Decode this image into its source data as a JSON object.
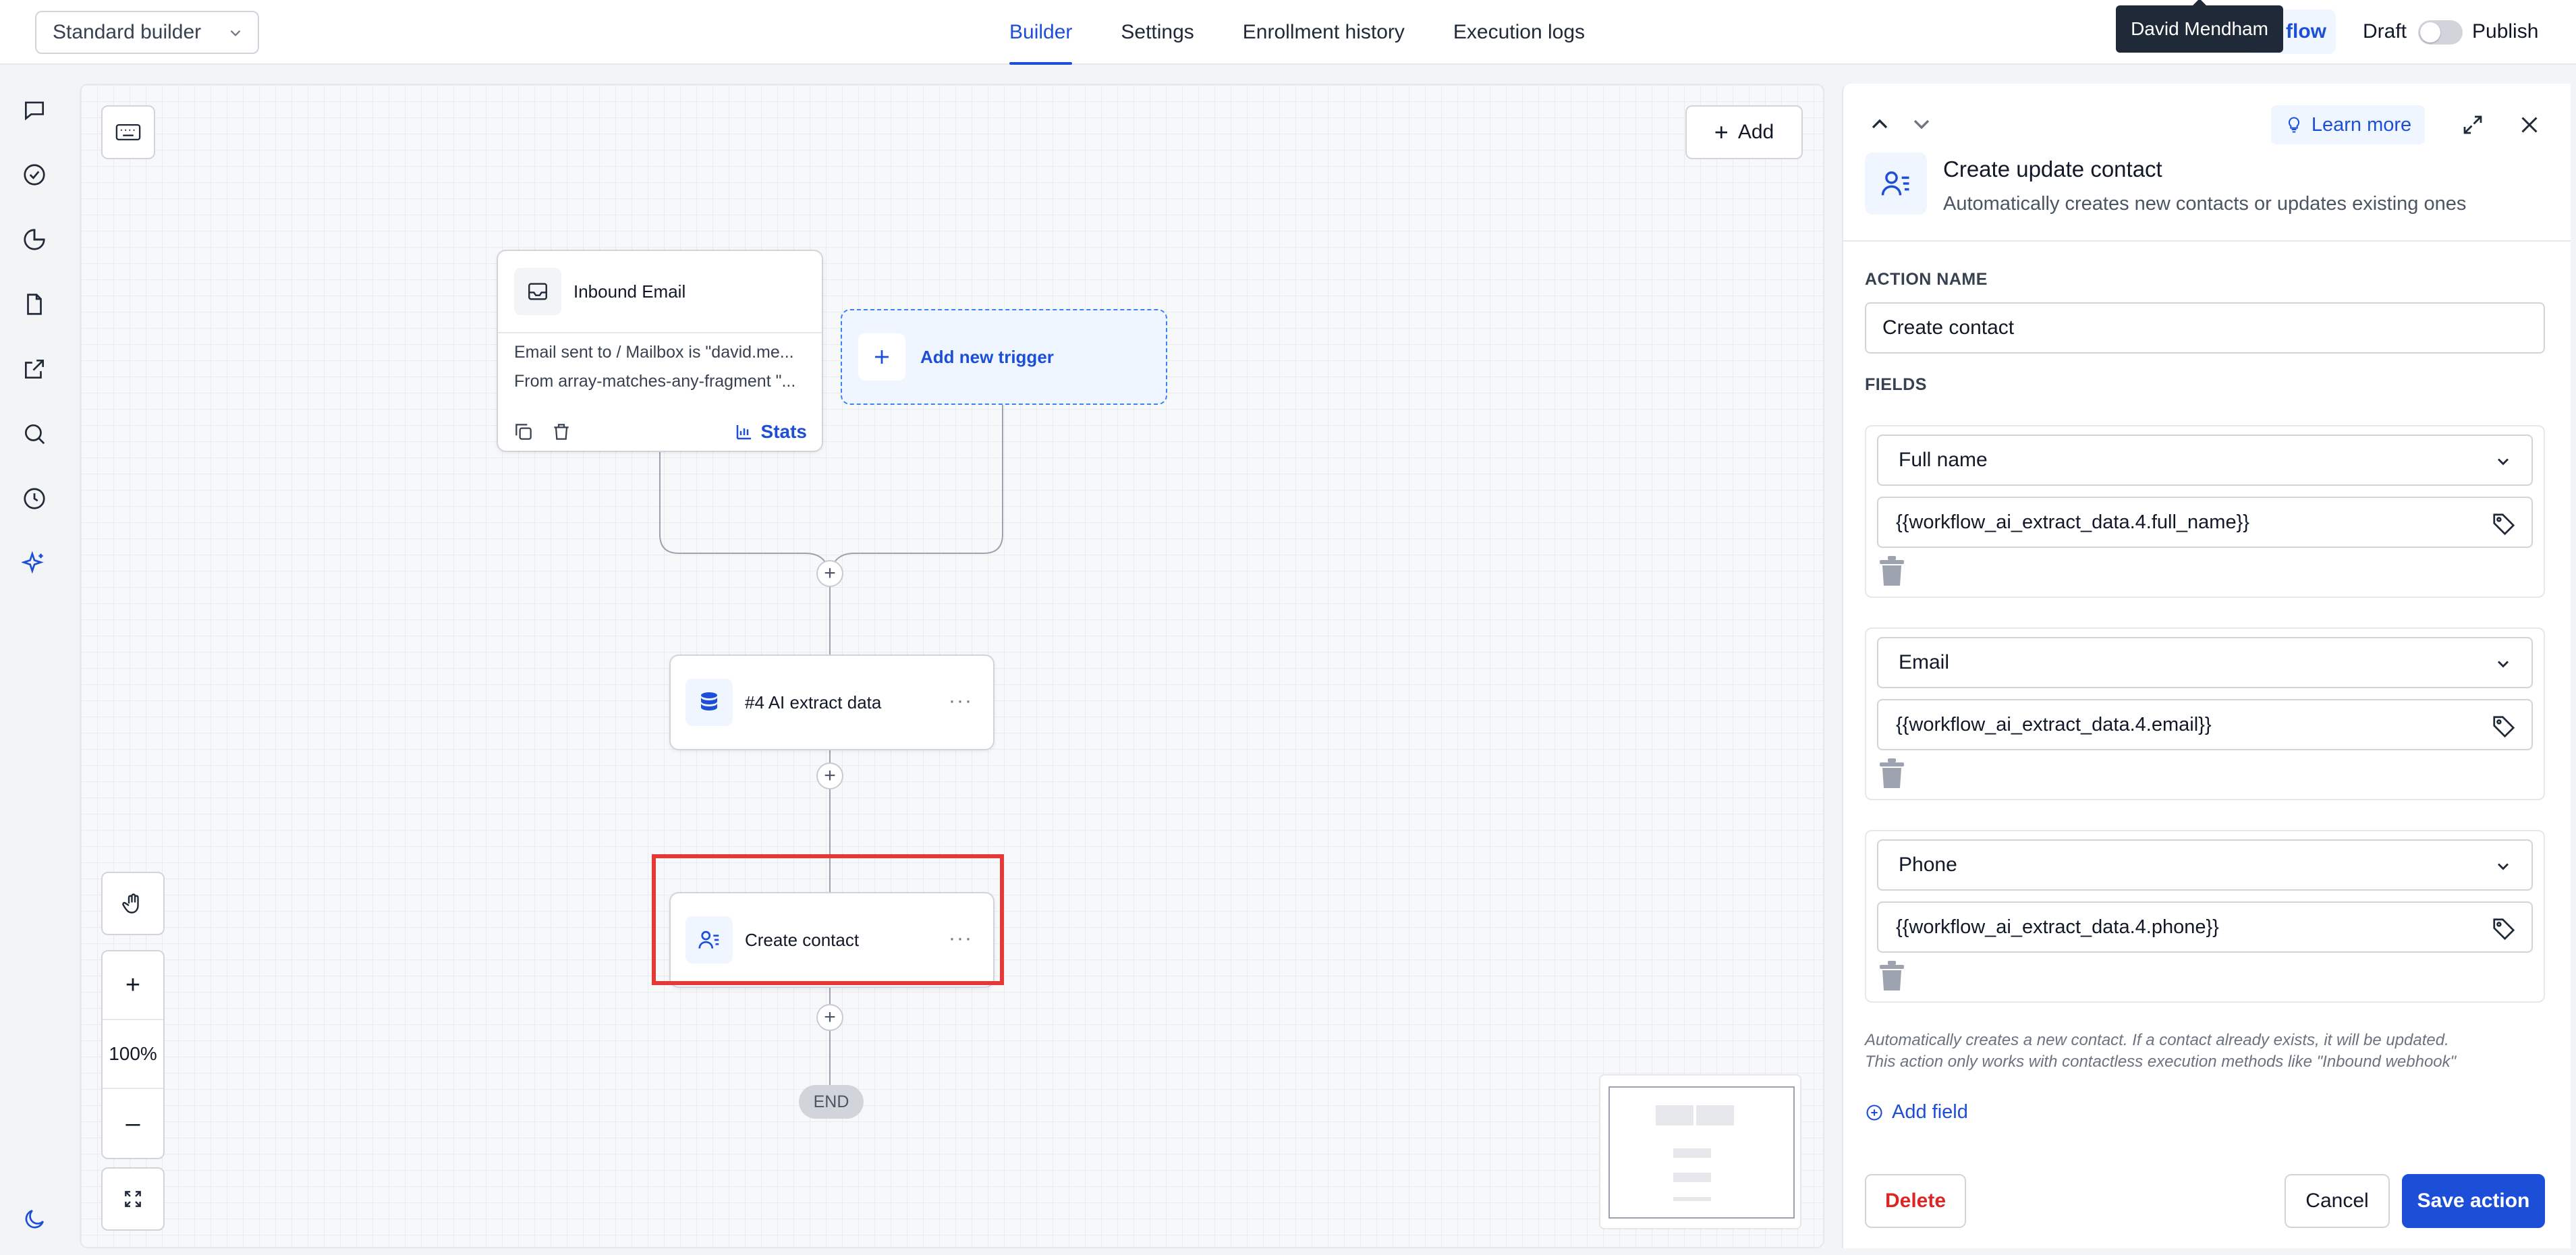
{
  "topbar": {
    "builder_select": "Standard builder",
    "tabs": [
      {
        "label": "Builder",
        "active": true
      },
      {
        "label": "Settings",
        "active": false
      },
      {
        "label": "Enrollment history",
        "active": false
      },
      {
        "label": "Execution logs",
        "active": false
      }
    ],
    "workflow_chip": "flow",
    "tooltip": "David Mendham",
    "draft_label": "Draft",
    "publish_label": "Publish",
    "publish_toggle_on": false
  },
  "leftnav": {
    "icons": [
      "chat-icon",
      "check-circle-icon",
      "pie-chart-icon",
      "document-icon",
      "external-link-icon",
      "search-icon",
      "clock-icon",
      "sparkles-icon",
      "moon-icon"
    ]
  },
  "canvas": {
    "add_button": "Add",
    "trigger": {
      "title": "Inbound Email",
      "line1": "Email sent to / Mailbox is \"david.me...",
      "line2": "From array-matches-any-fragment \"...",
      "stats": "Stats"
    },
    "add_trigger": "Add new trigger",
    "nodes": [
      {
        "title": "#4 AI extract data"
      },
      {
        "title": "Create contact"
      }
    ],
    "end_label": "END",
    "zoom": {
      "in": "+",
      "level": "100%",
      "out": "–"
    }
  },
  "panel": {
    "learn_more": "Learn more",
    "title": "Create update contact",
    "description": "Automatically creates new contacts or updates existing ones",
    "action_name_label": "ACTION NAME",
    "action_name_value": "Create contact",
    "fields_label": "FIELDS",
    "fields": [
      {
        "field": "Full name",
        "value": "{{workflow_ai_extract_data.4.full_name}}"
      },
      {
        "field": "Email",
        "value": "{{workflow_ai_extract_data.4.email}}"
      },
      {
        "field": "Phone",
        "value": "{{workflow_ai_extract_data.4.phone}}"
      }
    ],
    "note_line1": "Automatically creates a new contact. If a contact already exists, it will be updated.",
    "note_line2": "This action only works with contactless execution methods like \"Inbound webhook\"",
    "add_field": "Add field",
    "delete": "Delete",
    "cancel": "Cancel",
    "save": "Save action"
  },
  "colors": {
    "accent": "#1d4ed8",
    "danger": "#dc2626",
    "highlight": "#e53935"
  }
}
